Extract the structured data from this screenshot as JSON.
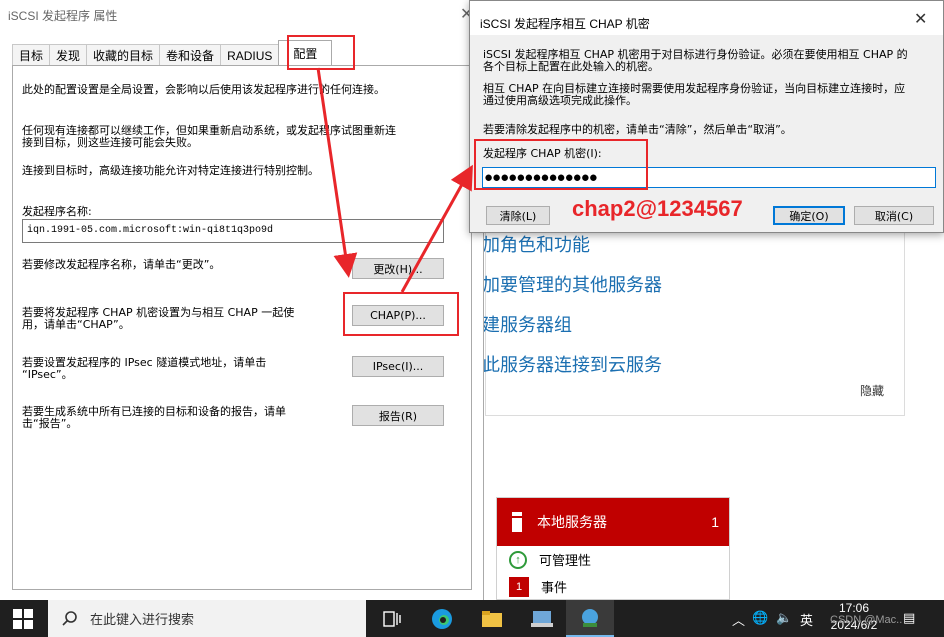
{
  "background": {
    "links": [
      "加角色和功能",
      "加要管理的其他服务器",
      "建服务器组",
      "此服务器连接到云服务"
    ],
    "hide_label": "隐藏",
    "tile": {
      "title": "本地服务器",
      "count": "1",
      "rows": [
        {
          "label": "可管理性",
          "badge": ""
        },
        {
          "label": "事件",
          "badge": "1"
        }
      ]
    }
  },
  "props_dialog": {
    "title": "iSCSI 发起程序 属性",
    "tabs": [
      "目标",
      "发现",
      "收藏的目标",
      "卷和设备",
      "RADIUS",
      "配置"
    ],
    "active_tab": "配置",
    "intro1": "此处的配置设置是全局设置，会影响以后使用该发起程序进行的任何连接。",
    "intro2_line1": "任何现有连接都可以继续工作，但如果重新启动系统，或发起程序试图重新连",
    "intro2_line2": "接到目标，则这些连接可能会失败。",
    "intro3": "连接到目标时，高级连接功能允许对特定连接进行特别控制。",
    "name_label": "发起程序名称:",
    "initiator_name": "iqn.1991-05.com.microsoft:win-qi8t1q3po9d",
    "change_text": "若要修改发起程序名称，请单击“更改”。",
    "change_button": "更改(H)...",
    "chap_text_line1": "若要将发起程序 CHAP 机密设置为与相互 CHAP 一起使",
    "chap_text_line2": "用，请单击“CHAP”。",
    "chap_button": "CHAP(P)...",
    "ipsec_text_line1": "若要设置发起程序的 IPsec 隧道模式地址，请单击",
    "ipsec_text_line2": "“IPsec”。",
    "ipsec_button": "IPsec(I)...",
    "report_text_line1": "若要生成系统中所有已连接的目标和设备的报告，请单",
    "report_text_line2": "击“报告”。",
    "report_button": "报告(R)"
  },
  "chap_dialog": {
    "title": "iSCSI 发起程序相互 CHAP 机密",
    "desc1_line1": "iSCSI 发起程序相互 CHAP 机密用于对目标进行身份验证。必须在要使用相互 CHAP 的",
    "desc1_line2": "各个目标上配置在此处输入的机密。",
    "desc2_line1": "相互 CHAP 在向目标建立连接时需要使用发起程序身份验证，当向目标建立连接时，应",
    "desc2_line2": "通过使用高级选项完成此操作。",
    "desc3": "若要清除发起程序中的机密，请单击“清除”，然后单击“取消”。",
    "secret_label": "发起程序 CHAP 机密(I):",
    "secret_value": "●●●●●●●●●●●●●●",
    "clear_button": "清除(L)",
    "ok_button": "确定(O)",
    "cancel_button": "取消(C)"
  },
  "annotation": {
    "text": "chap2@1234567",
    "color": "#e8262a"
  },
  "taskbar": {
    "search_placeholder": "在此键入进行搜索",
    "ime": "英",
    "time": "17:06",
    "date": "2024/6/2",
    "watermark": "CSDN @Mac.."
  },
  "icons": [
    "windows-start-icon",
    "search-icon",
    "task-view-icon",
    "edge-icon",
    "file-explorer-icon",
    "server-manager-icon",
    "iscsi-icon",
    "chevron-up-icon",
    "network-icon",
    "volume-icon",
    "notification-icon"
  ]
}
